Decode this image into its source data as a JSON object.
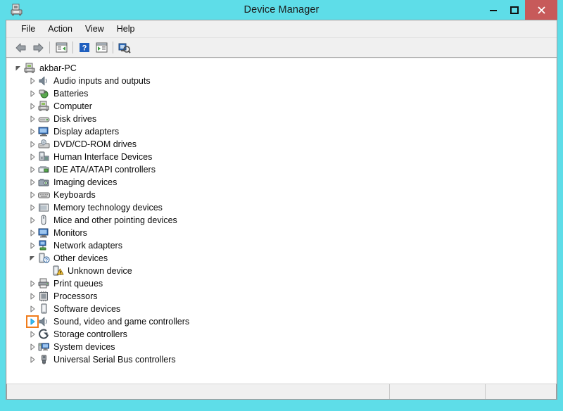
{
  "window": {
    "title": "Device Manager",
    "icon": "device-manager-icon",
    "frame_color": "#5edde8",
    "close_color": "#c75a5a"
  },
  "caption_buttons": [
    {
      "name": "minimize-button",
      "glyph": "minimize"
    },
    {
      "name": "maximize-button",
      "glyph": "maximize"
    },
    {
      "name": "close-button",
      "glyph": "close"
    }
  ],
  "menubar": {
    "items": [
      {
        "label": "File"
      },
      {
        "label": "Action"
      },
      {
        "label": "View"
      },
      {
        "label": "Help"
      }
    ]
  },
  "toolbar": {
    "buttons": [
      {
        "name": "back-button",
        "icon": "back-arrow-icon"
      },
      {
        "name": "forward-button",
        "icon": "forward-arrow-icon"
      },
      {
        "name": "show-hide-console-tree-button",
        "icon": "console-tree-icon"
      },
      {
        "name": "help-button",
        "icon": "question-mark-icon"
      },
      {
        "name": "properties-button",
        "icon": "properties-panel-icon"
      },
      {
        "name": "scan-hardware-changes-button",
        "icon": "scan-hardware-icon"
      }
    ]
  },
  "tree": {
    "root": {
      "label": "akbar-PC",
      "icon": "computer-icon",
      "expanded": true
    },
    "items": [
      {
        "label": "Audio inputs and outputs",
        "icon": "speaker-icon",
        "expanded": false,
        "depth": 1
      },
      {
        "label": "Batteries",
        "icon": "battery-icon",
        "expanded": false,
        "depth": 1
      },
      {
        "label": "Computer",
        "icon": "computer-icon",
        "expanded": false,
        "depth": 1
      },
      {
        "label": "Disk drives",
        "icon": "disk-drive-icon",
        "expanded": false,
        "depth": 1
      },
      {
        "label": "Display adapters",
        "icon": "display-icon",
        "expanded": false,
        "depth": 1
      },
      {
        "label": "DVD/CD-ROM drives",
        "icon": "dvd-drive-icon",
        "expanded": false,
        "depth": 1
      },
      {
        "label": "Human Interface Devices",
        "icon": "hid-icon",
        "expanded": false,
        "depth": 1
      },
      {
        "label": "IDE ATA/ATAPI controllers",
        "icon": "ide-controller-icon",
        "expanded": false,
        "depth": 1
      },
      {
        "label": "Imaging devices",
        "icon": "camera-icon",
        "expanded": false,
        "depth": 1
      },
      {
        "label": "Keyboards",
        "icon": "keyboard-icon",
        "expanded": false,
        "depth": 1
      },
      {
        "label": "Memory technology devices",
        "icon": "memory-icon",
        "expanded": false,
        "depth": 1
      },
      {
        "label": "Mice and other pointing devices",
        "icon": "mouse-icon",
        "expanded": false,
        "depth": 1
      },
      {
        "label": "Monitors",
        "icon": "monitor-icon",
        "expanded": false,
        "depth": 1
      },
      {
        "label": "Network adapters",
        "icon": "network-icon",
        "expanded": false,
        "depth": 1
      },
      {
        "label": "Other devices",
        "icon": "unknown-device-icon",
        "expanded": true,
        "depth": 1
      },
      {
        "label": "Unknown device",
        "icon": "warning-device-icon",
        "expanded": null,
        "depth": 2
      },
      {
        "label": "Print queues",
        "icon": "printer-icon",
        "expanded": false,
        "depth": 1
      },
      {
        "label": "Processors",
        "icon": "processor-icon",
        "expanded": false,
        "depth": 1
      },
      {
        "label": "Software devices",
        "icon": "software-device-icon",
        "expanded": false,
        "depth": 1
      },
      {
        "label": "Sound, video and game controllers",
        "icon": "speaker-icon",
        "expanded": false,
        "depth": 1,
        "highlighted": true
      },
      {
        "label": "Storage controllers",
        "icon": "storage-icon",
        "expanded": false,
        "depth": 1
      },
      {
        "label": "System devices",
        "icon": "system-device-icon",
        "expanded": false,
        "depth": 1
      },
      {
        "label": "Universal Serial Bus controllers",
        "icon": "usb-icon",
        "expanded": false,
        "depth": 1
      }
    ],
    "highlight_color": "#f07c1c"
  },
  "statusbar": {
    "main": "",
    "pane2": "",
    "pane3": ""
  }
}
